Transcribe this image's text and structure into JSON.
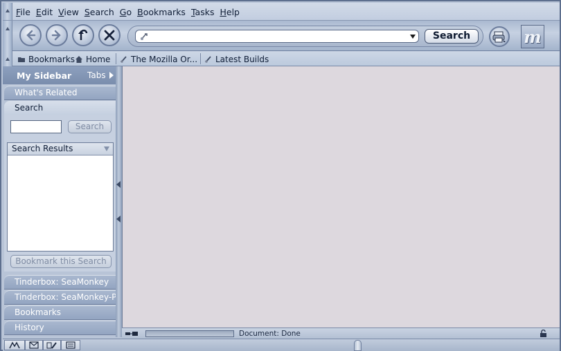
{
  "menu": [
    "File",
    "Edit",
    "View",
    "Search",
    "Go",
    "Bookmarks",
    "Tasks",
    "Help"
  ],
  "navbar": {
    "url_value": "",
    "search_label": "Search",
    "logo_letter": "m"
  },
  "personal_toolbar": {
    "bookmarks": "Bookmarks",
    "home": "Home",
    "mozilla": "The Mozilla Or...",
    "latest": "Latest Builds"
  },
  "sidebar": {
    "title": "My Sidebar",
    "tabs_label": "Tabs",
    "panels_top": [
      "What's Related",
      "Search"
    ],
    "search_input_value": "",
    "search_button": "Search",
    "results_header": "Search Results",
    "bookmark_search_button": "Bookmark this Search",
    "panels_bottom": [
      "Tinderbox: SeaMonkey",
      "Tinderbox: SeaMonkey-Po",
      "Bookmarks",
      "History"
    ]
  },
  "status": {
    "text": "Document: Done"
  },
  "colors": {
    "chrome": "#b9c5d8",
    "content": "#ddd8de",
    "sidebar_header": "#7a8dad"
  }
}
